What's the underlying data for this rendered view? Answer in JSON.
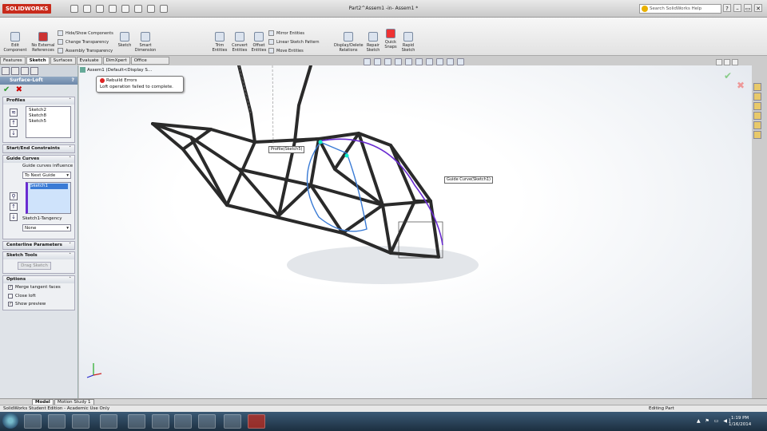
{
  "titlebar": {
    "logo": "SOLIDWORKS",
    "title": "Part2^Assem1 -in- Assem1 *",
    "search_placeholder": "Search SolidWorks Help",
    "window_controls": [
      "?",
      "–",
      "▭",
      "✕"
    ]
  },
  "ribbon": {
    "edit_component": "Edit Component",
    "no_external": "No External References",
    "hide_show": "Hide/Show Components",
    "change_transparency": "Change Transparency",
    "assembly_transparency": "Assembly Transparency",
    "sketch": "Sketch",
    "smart_dimension": "Smart Dimension",
    "trim": "Trim Entities",
    "convert": "Convert Entities",
    "offset": "Offset Entities",
    "mirror": "Mirror Entities",
    "linear_pattern": "Linear Sketch Pattern",
    "move": "Move Entities",
    "display_delete": "Display/Delete Relations",
    "repair": "Repair Sketch",
    "quick_snaps": "Quick Snaps",
    "rapid_sketch": "Rapid Sketch"
  },
  "tabs": [
    "Features",
    "Sketch",
    "Surfaces",
    "Evaluate",
    "DimXpert",
    "Office Products"
  ],
  "panel": {
    "title": "Surface-Loft",
    "help": "?",
    "ok": "✔",
    "cancel": "✖",
    "profiles_header": "Profiles",
    "profiles": [
      "Sketch2",
      "Sketch8",
      "Sketch5"
    ],
    "startend_header": "Start/End Constraints",
    "guide_header": "Guide Curves",
    "guide_influence_label": "Guide curves influence",
    "guide_influence_value": "To Next Guide",
    "guide_list": [
      "Sketch1"
    ],
    "tangency_label": "Sketch1-Tangency",
    "tangency_value": "None",
    "centerline_header": "Centerline Parameters",
    "sketchtools_header": "Sketch Tools",
    "drag_sketch": "Drag Sketch",
    "options_header": "Options",
    "opt_merge": "Merge tangent faces",
    "opt_close": "Close loft",
    "opt_preview": "Show preview"
  },
  "tree": {
    "root": "Assem1  (Default<Display S..."
  },
  "error": {
    "title": "Rebuild Errors",
    "message": "Loft operation failed to complete."
  },
  "callouts": {
    "profile": "Profile(Sketch5)",
    "guide": "Guide Curve(Sketch1)"
  },
  "bottom_tabs": [
    "Model",
    "Motion Study 1"
  ],
  "status": {
    "left": "SolidWorks Student Edition - Academic Use Only",
    "editing": "Editing Part"
  },
  "clock": {
    "time": "1:19 PM",
    "date": "1/16/2014"
  },
  "colors": {
    "accent": "#c82b1c",
    "guide_curve": "#6a2bd1",
    "profile": "#3a7bd5"
  }
}
